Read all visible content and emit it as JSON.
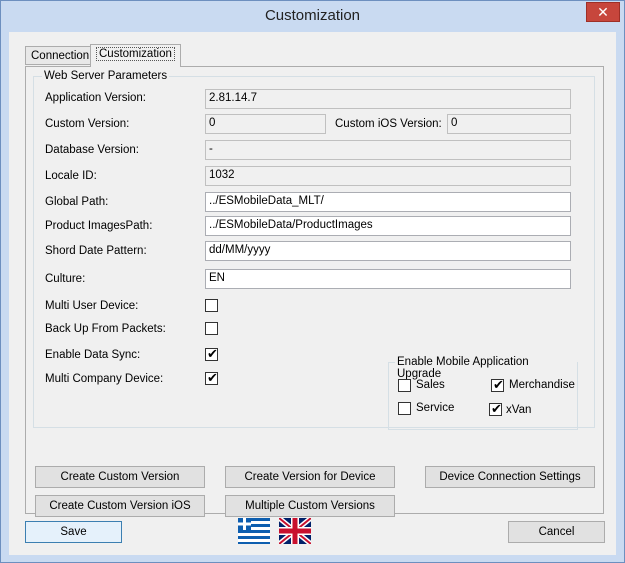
{
  "window": {
    "title": "Customization",
    "close_glyph": "✕"
  },
  "tabs": [
    {
      "label": "Connection"
    },
    {
      "label": "Customization"
    }
  ],
  "web_server": {
    "legend": "Web Server Parameters",
    "app_version": {
      "label": "Application Version:",
      "value": "2.81.14.7"
    },
    "custom_version": {
      "label": "Custom Version:",
      "value": "0"
    },
    "custom_ios_version": {
      "label": "Custom iOS Version:",
      "value": "0"
    },
    "database_version": {
      "label": "Database Version:",
      "value": "-"
    },
    "locale_id": {
      "label": "Locale ID:",
      "value": "1032"
    },
    "global_path": {
      "label": "Global Path:",
      "value": "../ESMobileData_MLT/"
    },
    "product_images_path": {
      "label": "Product ImagesPath:",
      "value": "../ESMobileData/ProductImages"
    },
    "short_date_pattern": {
      "label": "Shord Date Pattern:",
      "value": "dd/MM/yyyy"
    },
    "culture": {
      "label": "Culture:",
      "value": "EN"
    },
    "multi_user_device": {
      "label": "Multi User Device:",
      "checked": false
    },
    "back_up_from_packets": {
      "label": "Back Up From Packets:",
      "checked": false
    },
    "enable_data_sync": {
      "label": "Enable Data Sync:",
      "checked": true
    },
    "multi_company_device": {
      "label": "Multi Company Device:",
      "checked": true
    }
  },
  "upgrade": {
    "legend": "Enable Mobile Application Upgrade",
    "sales": {
      "label": "Sales",
      "checked": false
    },
    "merchandise": {
      "label": "Merchandise",
      "checked": true
    },
    "service": {
      "label": "Service",
      "checked": false
    },
    "xvan": {
      "label": "xVan",
      "checked": true
    }
  },
  "check_glyph": "✔",
  "buttons": {
    "create_custom_version": "Create Custom Version",
    "create_version_for_device": "Create Version for Device",
    "device_connection_settings": "Device Connection Settings",
    "create_custom_version_ios": "Create Custom Version iOS",
    "multiple_custom_versions": "Multiple Custom Versions",
    "save": "Save",
    "cancel": "Cancel"
  },
  "flags": {
    "greek": "greek-flag-icon",
    "uk": "uk-flag-icon"
  },
  "colors": {
    "window_frame": "#c9daf1",
    "close": "#c7463c",
    "flag_blue": "#0d5eaf",
    "uk_red": "#c8102e",
    "uk_blue": "#012169"
  }
}
